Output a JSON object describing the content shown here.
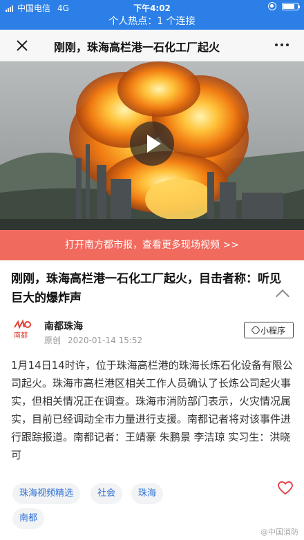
{
  "status_bar": {
    "carrier": "中国电信",
    "network": "4G",
    "time": "下午4:02",
    "battery_percent": 80
  },
  "hot_bar": {
    "text": "个人热点：1 个连接"
  },
  "nav": {
    "title": "刚刚，珠海高栏港一石化工厂起火",
    "close_icon": "close-icon",
    "more_icon": "more-icon"
  },
  "video": {
    "play_icon": "play-icon"
  },
  "promo": {
    "text": "打开南方都市报，查看更多现场视频 >>"
  },
  "article": {
    "title": "刚刚，珠海高栏港一石化工厂起火，目击者称：听见巨大的爆炸声",
    "source_name": "南都珠海",
    "original_label": "原创",
    "timestamp": "2020-01-14 15:52",
    "mini_program_label": "小程序",
    "body": "1月14日14时许，位于珠海高栏港的珠海长炼石化设备有限公司起火。珠海市高栏港区相关工作人员确认了长炼公司起火事实，但相关情况正在调查。珠海市消防部门表示，火灾情况属实，目前已经调动全市力量进行支援。南都记者将对该事件进行跟踪报道。南都记者：王靖豪 朱鹏景 李洁琼 实习生：洪晓可"
  },
  "logo": {
    "text": "南都"
  },
  "tags": [
    "珠海视频精选",
    "社会",
    "珠海",
    "南都"
  ],
  "watermark": "@中国消防",
  "colors": {
    "brand_blue": "#2c7fe6",
    "promo_red": "#f16a5e",
    "tag_blue": "#2f73d8",
    "like_red": "#e4393c"
  }
}
